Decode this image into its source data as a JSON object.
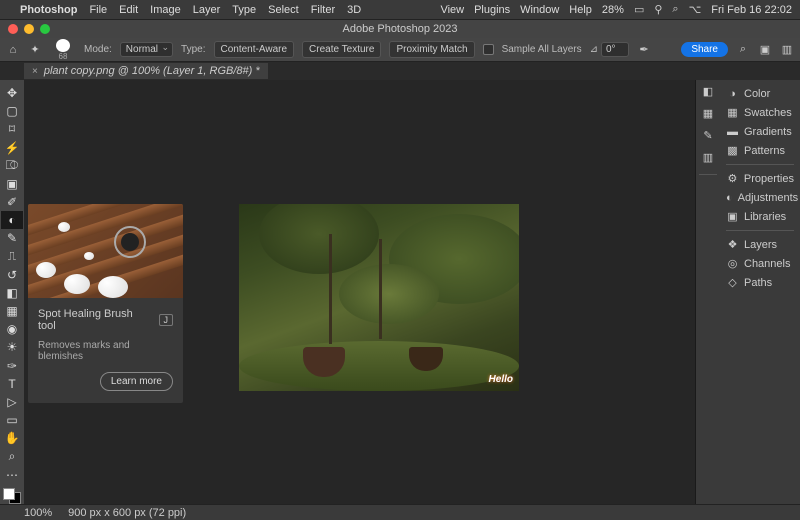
{
  "menubar": {
    "app": "Photoshop",
    "items": [
      "File",
      "Edit",
      "Image",
      "Layer",
      "Type",
      "Select",
      "Filter",
      "3D"
    ],
    "right_items": [
      "View",
      "Plugins",
      "Window",
      "Help"
    ],
    "battery": "28%",
    "datetime": "Fri Feb 16  22:02"
  },
  "titlebar": {
    "title": "Adobe Photoshop 2023"
  },
  "traffic": {
    "close": "#ff5f57",
    "min": "#febc2e",
    "max": "#28c840"
  },
  "optbar": {
    "mode_label": "Mode:",
    "mode_value": "Normal",
    "type_label": "Type:",
    "btn_content": "Content-Aware",
    "btn_texture": "Create Texture",
    "btn_proximity": "Proximity Match",
    "sample_label": "Sample All Layers",
    "angle_label": "⊿",
    "angle_value": "0°",
    "brush_size": "68",
    "share": "Share"
  },
  "doc_tab": {
    "label": "plant copy.png @ 100% (Layer 1, RGB/8#) *"
  },
  "tooltip": {
    "title": "Spot Healing Brush tool",
    "key": "J",
    "desc": "Removes marks and blemishes",
    "learn": "Learn more"
  },
  "canvas": {
    "watermark": "Hello"
  },
  "panels": {
    "group1": [
      "Color",
      "Swatches",
      "Gradients",
      "Patterns"
    ],
    "group2": [
      "Properties",
      "Adjustments",
      "Libraries"
    ],
    "group3": [
      "Layers",
      "Channels",
      "Paths"
    ]
  },
  "status": {
    "zoom": "100%",
    "dims": "900 px x 600 px (72 ppi)"
  }
}
